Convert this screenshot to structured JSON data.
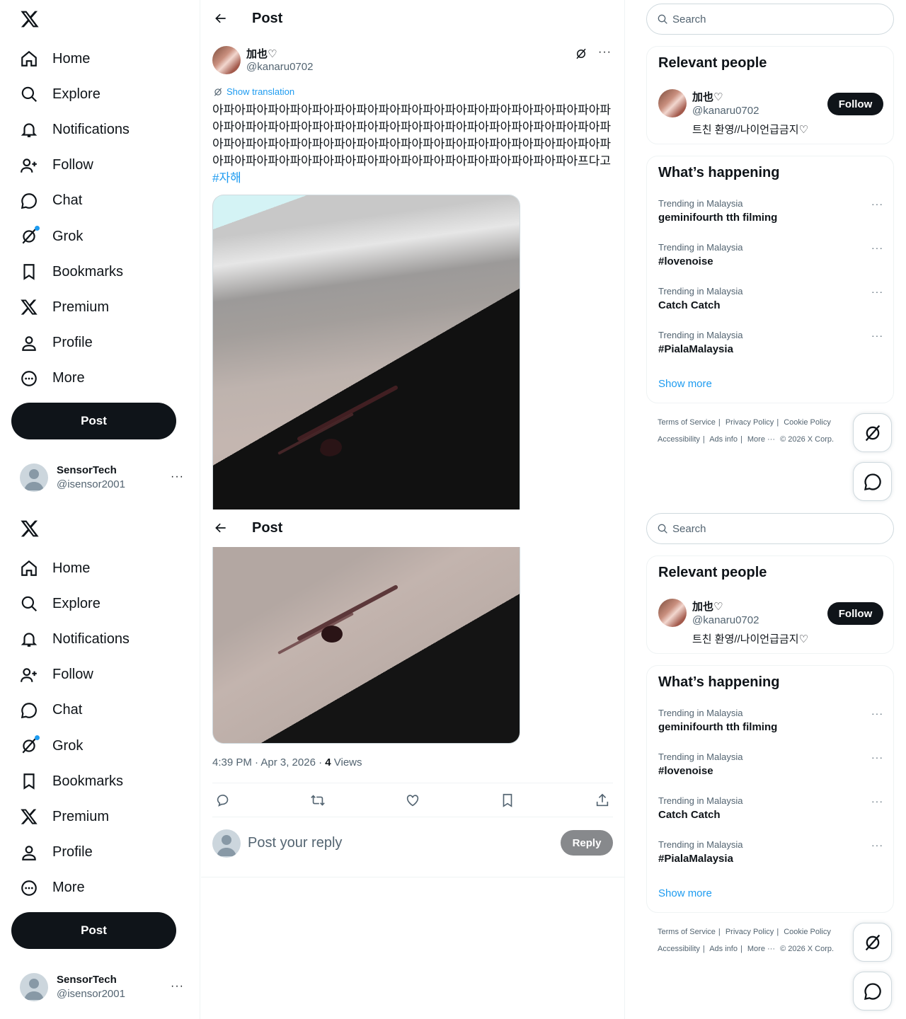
{
  "nav": {
    "items": [
      {
        "label": "Home",
        "icon": "home-icon"
      },
      {
        "label": "Explore",
        "icon": "search-icon"
      },
      {
        "label": "Notifications",
        "icon": "bell-icon"
      },
      {
        "label": "Follow",
        "icon": "person-add-icon"
      },
      {
        "label": "Chat",
        "icon": "chat-icon"
      },
      {
        "label": "Grok",
        "icon": "grok-icon"
      },
      {
        "label": "Bookmarks",
        "icon": "bookmark-icon"
      },
      {
        "label": "Premium",
        "icon": "x-logo-icon"
      },
      {
        "label": "Profile",
        "icon": "person-icon"
      },
      {
        "label": "More",
        "icon": "more-circle-icon"
      }
    ],
    "post_label": "Post"
  },
  "account": {
    "name": "SensorTech",
    "handle": "@isensor2001",
    "more": "···"
  },
  "header": {
    "title": "Post"
  },
  "post": {
    "author_name": "加也♡",
    "author_handle": "@kanaru0702",
    "more": "···",
    "translate_label": "Show translation",
    "text": "아파아파아파아파아파아파아파아파아파아파아파아파아파아파아파아파아파아파아파아파아파아파아파아파아파아파아파아파아파아파아파아파아파아파아파아파아파아파아파아파아파아파아파아파아파아파아파아파아파아파아파아파아파아파아파아파아파아파아파아파아파아파아파아파아파아파아파아파아파아파아프다고 ",
    "hashtag": "#자해",
    "time": "4:39 PM · Apr 3, 2026 · ",
    "views_count": "4",
    "views_label": " Views"
  },
  "reply": {
    "placeholder": "Post your reply",
    "button": "Reply"
  },
  "search": {
    "placeholder": "Search"
  },
  "relevant": {
    "title": "Relevant people",
    "name": "加也♡",
    "handle": "@kanaru0702",
    "bio": "트친 환영//나이언급금지♡",
    "follow": "Follow"
  },
  "happening": {
    "title": "What’s happening",
    "trends": [
      {
        "caption": "Trending in Malaysia",
        "title": "geminifourth tth filming"
      },
      {
        "caption": "Trending in Malaysia",
        "title": "#lovenoise"
      },
      {
        "caption": "Trending in Malaysia",
        "title": "Catch Catch"
      },
      {
        "caption": "Trending in Malaysia",
        "title": "#PialaMalaysia"
      }
    ],
    "show_more": "Show more"
  },
  "footer": {
    "tos": "Terms of Service",
    "privacy": "Privacy Policy",
    "cookie": "Cookie Policy",
    "accessibility": "Accessibility",
    "ads": "Ads info",
    "more": "More ···",
    "copyright": "© 2026 X Corp."
  },
  "colors": {
    "accent": "#1d9bf0",
    "text": "#0f1419",
    "muted": "#536471",
    "border": "#eff3f4"
  }
}
